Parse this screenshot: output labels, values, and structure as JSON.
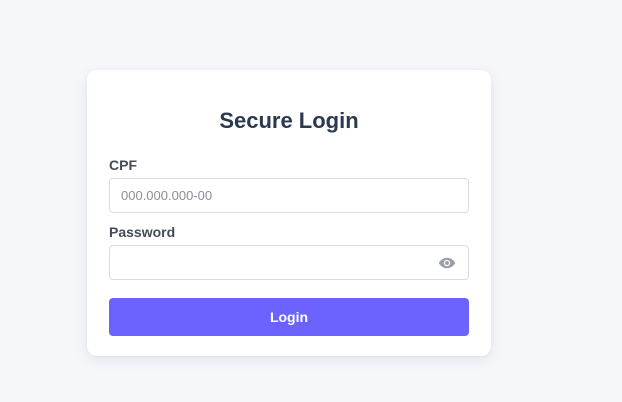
{
  "login": {
    "title": "Secure Login",
    "cpf": {
      "label": "CPF",
      "value": "",
      "placeholder": "000.000.000-00"
    },
    "password": {
      "label": "Password",
      "value": "",
      "placeholder": "",
      "toggle_icon": "eye-icon"
    },
    "submit_label": "Login"
  },
  "colors": {
    "page_background": "#f5f7fb",
    "card_background": "#ffffff",
    "accent": "#6c63ff",
    "title_text": "#2b3a4e",
    "label_text": "#444b56",
    "border": "#d9dde3"
  }
}
